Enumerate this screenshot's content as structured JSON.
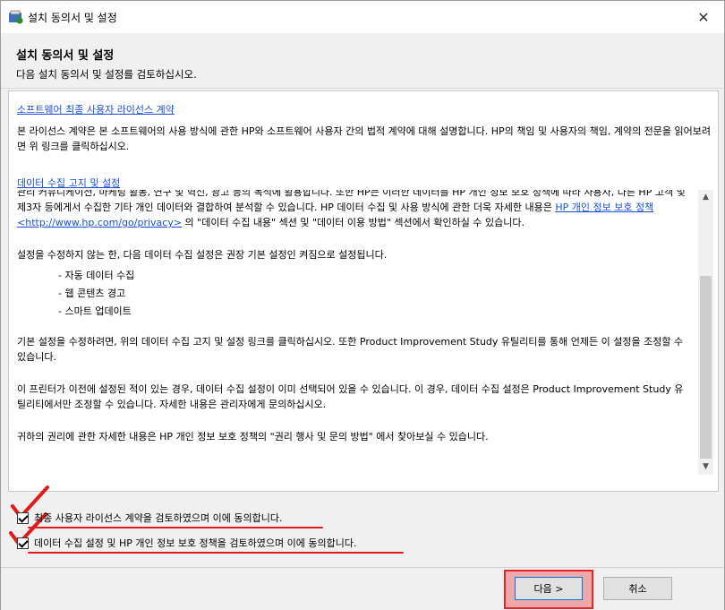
{
  "window": {
    "title": "설치 동의서 및 설정",
    "close_label": "✕"
  },
  "header": {
    "title": "설치 동의서 및 설정",
    "subtitle": "다음 설치 동의서 및 설정를 검토하십시오."
  },
  "eula": {
    "link": "소프트웨어 최종 사용자 라이선스 계약",
    "text": "본 라이선스 계약은 본 소프트웨어의 사용 방식에 관한 HP와 소프트웨어 사용자 간의 법적 계약에 대해 설명합니다. HP의 책임 및 사용자의 책임, 계약의 전문을 읽어보려면 위 링크를 클릭하십시오."
  },
  "privacy": {
    "link": "데이터 수집 고지 및 설정",
    "p1_cut": "관리 커뮤니케이션, 마케팅 활동, 연구 및 혁신, 광고 등의 목적에 활용합니다. 또한 HP는 이러한 데이터를 HP 개인 정보 보호 정책에 따라 사용자, 다른 HP 고객 및 제3자 등에게서 수집한 기타 개인 데이터와 결합하여 분석할 수 있습니다. HP 데이터 수집 및 사용 방식에 관한 더욱 자세한 내용은",
    "p1_link": "HP 개인 정보 보호 정책 <http://www.hp.com/go/privacy>",
    "p1_tail": "의 \"데이터 수집 내용\" 섹션 및 \"데이터 이용 방법\" 섹션에서 확인하실 수 있습니다.",
    "p2": "설정을 수정하지 않는 한, 다음 데이터 수집 설정은 권장 기본 설정인 켜짐으로 설정됩니다.",
    "bullets": [
      "- 자동 데이터 수집",
      "- 웹 콘텐츠 경고",
      "- 스마트 업데이트"
    ],
    "p3": "기본 설정을 수정하려면, 위의 데이터 수집 고지 및 설정 링크를 클릭하십시오. 또한 Product Improvement Study 유틸리티를 통해 언제든 이 설정을 조정할 수 있습니다.",
    "p4": "이 프린터가 이전에 설정된 적이 있는 경우, 데이터 수집 설정이 이미 선택되어 있을 수 있습니다. 이 경우, 데이터 수집 설정은 Product Improvement Study 유틸리티에서만 조정할 수 있습니다. 자세한 내용은 관리자에게 문의하십시오.",
    "p5": "귀하의 권리에 관한 자세한 내용은 HP 개인 정보 보호 정책의 \"권리 행사 및 문의 방법\" 에서 찾아보실 수 있습니다."
  },
  "checkboxes": [
    {
      "label": "최종 사용자 라이선스 계약을 검토하였으며 이에 동의합니다.",
      "checked": true
    },
    {
      "label": "데이터 수집 설정 및 HP 개인 정보 보호 정책을 검토하였으며 이에 동의합니다.",
      "checked": true
    }
  ],
  "buttons": {
    "next": "다음 >",
    "cancel": "취소"
  },
  "colors": {
    "link": "#1a4fd6",
    "annotation_red": "#e01b1b"
  }
}
